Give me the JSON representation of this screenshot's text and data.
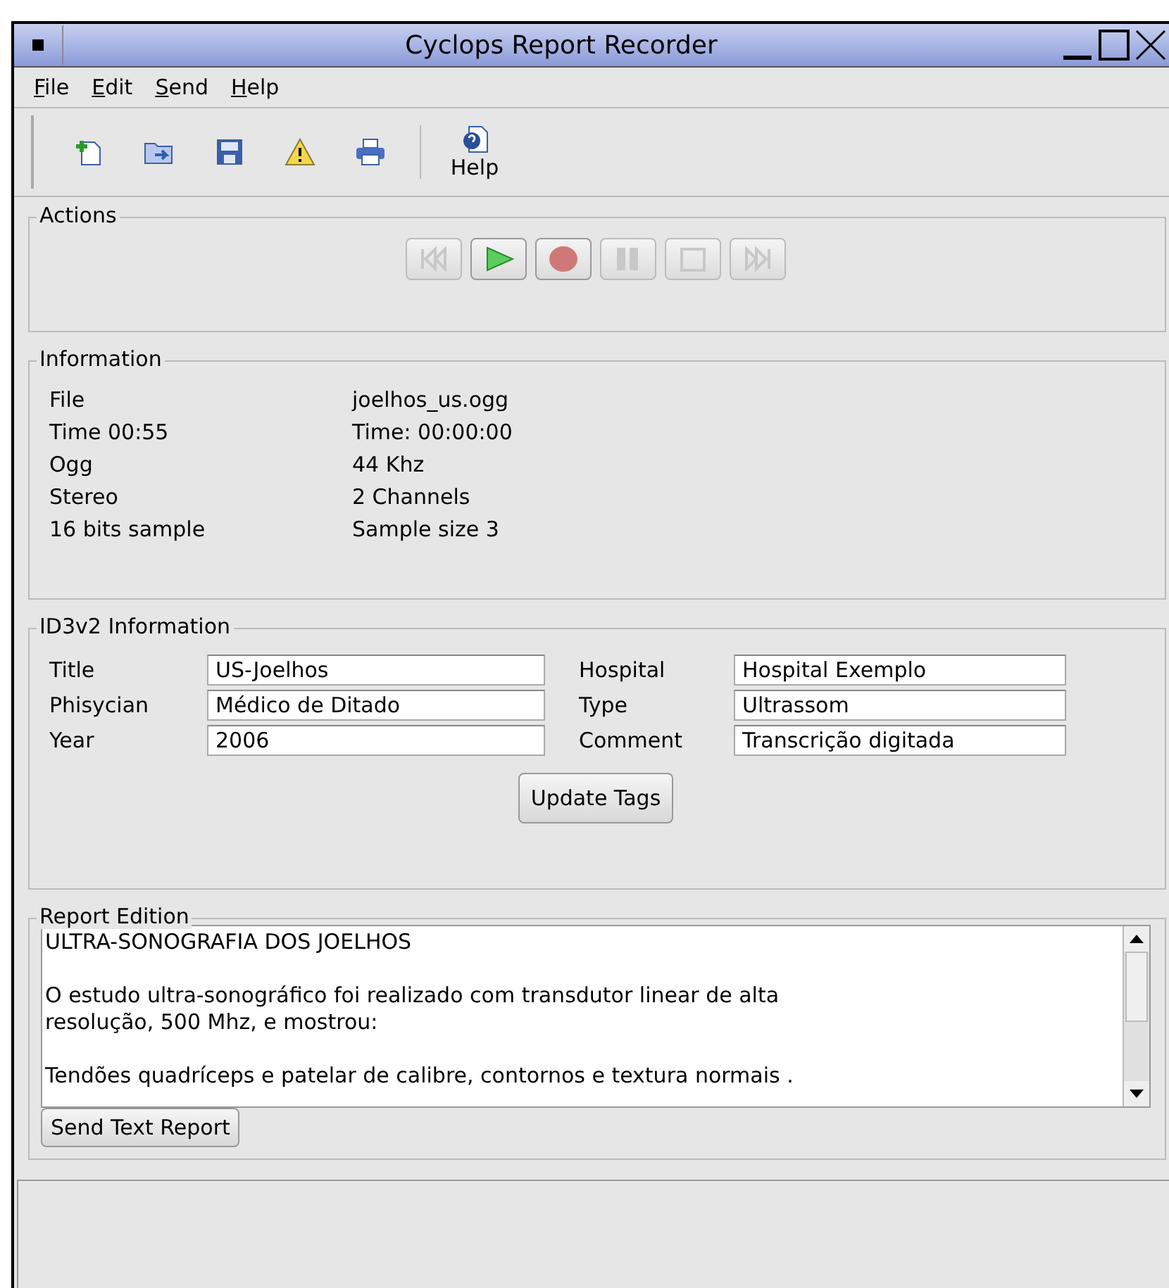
{
  "window": {
    "title": "Cyclops Report Recorder"
  },
  "menu": [
    {
      "label": "File"
    },
    {
      "label": "Edit"
    },
    {
      "label": "Send"
    },
    {
      "label": "Help"
    }
  ],
  "toolbar": [
    {
      "kind": "new"
    },
    {
      "kind": "open"
    },
    {
      "kind": "save"
    },
    {
      "kind": "warning"
    },
    {
      "kind": "print"
    },
    {
      "kind": "help",
      "label": "Help"
    }
  ],
  "actions": {
    "title": "Actions",
    "buttons": [
      {
        "kind": "rewind",
        "disabled": true
      },
      {
        "kind": "play",
        "disabled": false
      },
      {
        "kind": "record",
        "disabled": false
      },
      {
        "kind": "pause",
        "disabled": true
      },
      {
        "kind": "stop",
        "disabled": true
      },
      {
        "kind": "forward",
        "disabled": true
      }
    ]
  },
  "information": {
    "title": "Information",
    "rows": [
      {
        "left": "File",
        "right": "joelhos_us.ogg"
      },
      {
        "left": "Time 00:55",
        "right": "Time: 00:00:00"
      },
      {
        "left": "Ogg",
        "right": "44 Khz"
      },
      {
        "left": "Stereo",
        "right": "2 Channels"
      },
      {
        "left": "16 bits sample",
        "right": "Sample size 3"
      }
    ]
  },
  "id3": {
    "title": "ID3v2 Information",
    "fields": [
      {
        "label": "Title",
        "value": "US-Joelhos"
      },
      {
        "label": "Hospital",
        "value": "Hospital Exemplo"
      },
      {
        "label": "Phisycian",
        "value": "Médico de Ditado"
      },
      {
        "label": "Type",
        "value": "Ultrassom"
      },
      {
        "label": "Year",
        "value": "2006"
      },
      {
        "label": "Comment",
        "value": "Transcrição digitada"
      }
    ],
    "button": "Update Tags"
  },
  "report": {
    "title": "Report Edition",
    "paragraphs": [
      [
        "ULTRA-SONOGRAFIA DOS JOELHOS"
      ],
      [
        "O estudo ultra-sonográfico foi realizado com transdutor linear de alta",
        "resolução, 500 Mhz, e mostrou:"
      ],
      [
        "Tendões quadríceps e patelar de calibre, contornos e textura normais ."
      ]
    ],
    "button": "Send Text Report"
  }
}
